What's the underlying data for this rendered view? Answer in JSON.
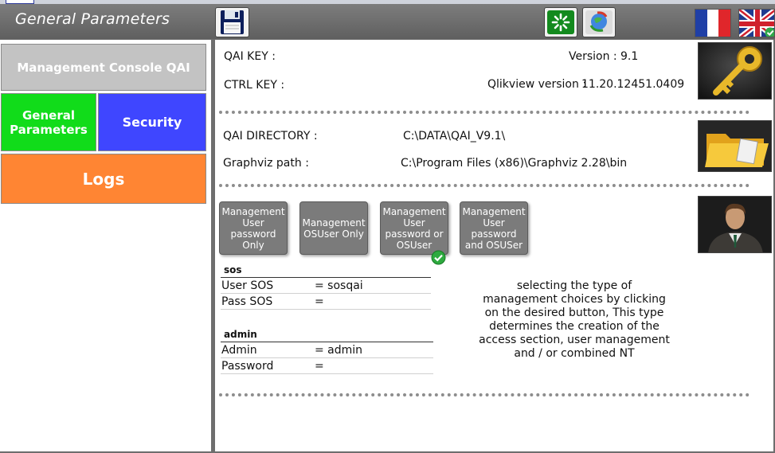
{
  "window": {
    "title": "General Parameters"
  },
  "toolbar": {
    "save_icon": "floppy-disk-icon",
    "reload_icon": "loading-spinner-icon",
    "refresh_icon": "refresh-globe-icon",
    "lang_fr_icon": "french-flag-icon",
    "lang_uk_icon": "uk-flag-icon"
  },
  "sidebar": {
    "console": "Management Console QAI",
    "general": "General Parameters",
    "security": "Security",
    "logs": "Logs"
  },
  "keys": {
    "qai_key_label": "QAI KEY :",
    "qai_key_value": "",
    "ctrl_key_label": "CTRL KEY :",
    "ctrl_key_value": "",
    "version_label": "Version :",
    "version_value": "9.1",
    "qlikview_label": "Qlikview version :",
    "qlikview_value": "11.20.12451.0409"
  },
  "paths": {
    "qai_dir_label": "QAI DIRECTORY :",
    "qai_dir_value": "C:\\DATA\\QAI_V9.1\\",
    "graphviz_label": "Graphviz path :",
    "graphviz_value": "C:\\Program Files (x86)\\Graphviz 2.28\\bin"
  },
  "modes": [
    {
      "label": "Management User password Only"
    },
    {
      "label": "Management OSUser Only"
    },
    {
      "label": "Management User password or OSUser",
      "selected": true
    },
    {
      "label": "Management User password and OSUSer"
    }
  ],
  "sos": {
    "title": "sos",
    "user_label": "User SOS",
    "user_value": "= sosqai",
    "pass_label": "Pass SOS",
    "pass_value": "="
  },
  "admin": {
    "title": "admin",
    "admin_label": "Admin",
    "admin_value": "= admin",
    "password_label": "Password",
    "password_value": "="
  },
  "description": "selecting the type of management choices by clicking on the desired button, This type determines the creation of the access section, user management and / or combined NT",
  "colors": {
    "general_active": "#11dc1a",
    "security": "#3f46ff",
    "logs": "#ff8533",
    "console": "#c3c3c3"
  }
}
